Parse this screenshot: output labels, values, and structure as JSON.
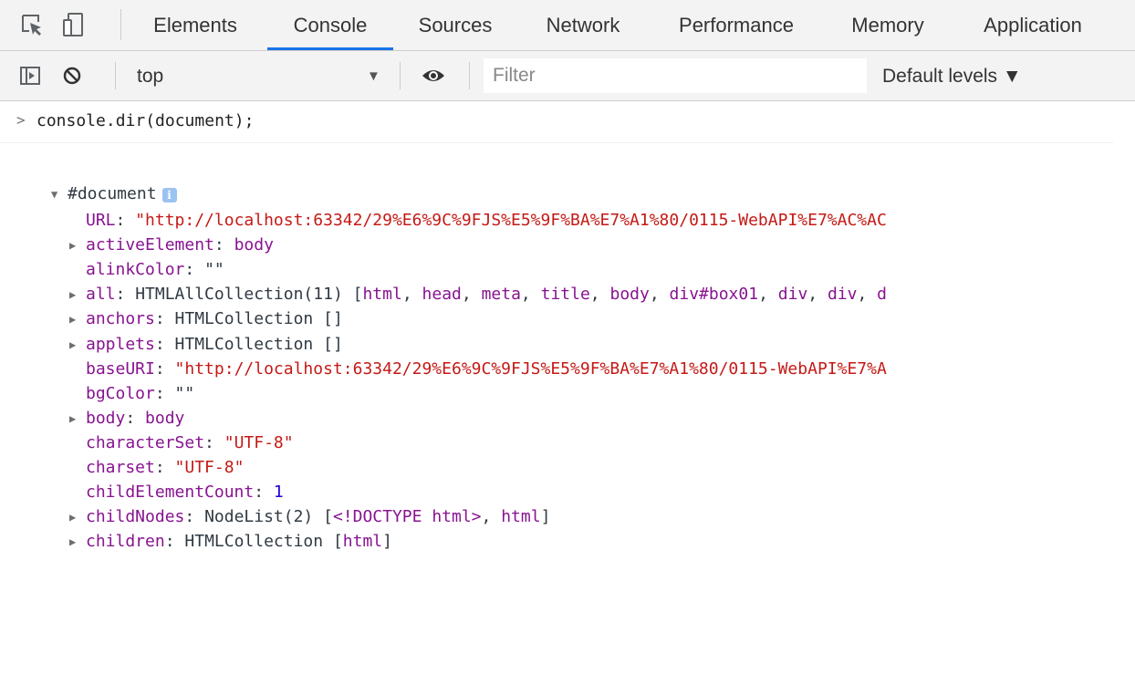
{
  "tabs": [
    "Elements",
    "Console",
    "Sources",
    "Network",
    "Performance",
    "Memory",
    "Application"
  ],
  "active_tab": "Console",
  "toolbar": {
    "context": "top",
    "filter_placeholder": "Filter",
    "levels": "Default levels ▼"
  },
  "icons": {
    "inspect": "inspect-element-icon",
    "device": "device-toggle-icon",
    "sidebar": "show-sidebar-icon",
    "clear": "clear-console-icon",
    "eye": "live-expression-eye-icon",
    "info": "info-icon"
  },
  "colors": {
    "active_tab_underline": "#1a73e8",
    "key": "#881391",
    "string": "#c41a16",
    "number": "#1c00cf"
  },
  "console": {
    "command": "console.dir(document);",
    "root": "#document",
    "props": [
      {
        "key": "URL",
        "sep": ": ",
        "value": "\"http://localhost:63342/29%E6%9C%9FJS%E5%9F%BA%E7%A1%80/0115-WebAPI%E7%AC%AC",
        "kind": "str",
        "expandable": false
      },
      {
        "key": "activeElement",
        "sep": ": ",
        "value": "body",
        "kind": "ident",
        "expandable": true
      },
      {
        "key": "alinkColor",
        "sep": ": ",
        "value": "\"\"",
        "kind": "plain",
        "expandable": false
      },
      {
        "key": "all",
        "sep": ": ",
        "value": "HTMLAllCollection(11) [html, head, meta, title, body, div#box01, div, div, d",
        "kind": "coll",
        "expandable": true
      },
      {
        "key": "anchors",
        "sep": ": ",
        "value": "HTMLCollection []",
        "kind": "coll",
        "expandable": true
      },
      {
        "key": "applets",
        "sep": ": ",
        "value": "HTMLCollection []",
        "kind": "coll",
        "expandable": true
      },
      {
        "key": "baseURI",
        "sep": ": ",
        "value": "\"http://localhost:63342/29%E6%9C%9FJS%E5%9F%BA%E7%A1%80/0115-WebAPI%E7%A",
        "kind": "str",
        "expandable": false
      },
      {
        "key": "bgColor",
        "sep": ": ",
        "value": "\"\"",
        "kind": "plain",
        "expandable": false
      },
      {
        "key": "body",
        "sep": ": ",
        "value": "body",
        "kind": "ident",
        "expandable": true
      },
      {
        "key": "characterSet",
        "sep": ": ",
        "value": "\"UTF-8\"",
        "kind": "str",
        "expandable": false
      },
      {
        "key": "charset",
        "sep": ": ",
        "value": "\"UTF-8\"",
        "kind": "str",
        "expandable": false
      },
      {
        "key": "childElementCount",
        "sep": ": ",
        "value": "1",
        "kind": "num",
        "expandable": false
      },
      {
        "key": "childNodes",
        "sep": ": ",
        "value": "NodeList(2) [<!DOCTYPE html>, html]",
        "kind": "coll",
        "expandable": true
      },
      {
        "key": "children",
        "sep": ": ",
        "value": "HTMLCollection [html]",
        "kind": "coll",
        "expandable": true
      }
    ]
  }
}
